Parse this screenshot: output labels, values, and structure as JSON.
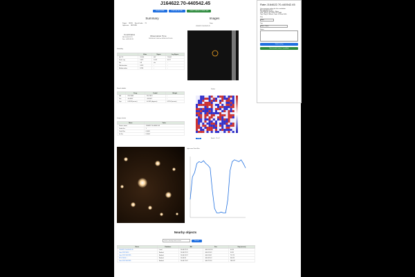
{
  "header": {
    "title": "J164622.70-440542.45",
    "buttons": [
      "SUBSCRIBE",
      "DISPLAY MORE",
      "LIGHTCURVE DOWNLOAD"
    ]
  },
  "summary": {
    "title": "Summary",
    "rows": [
      {
        "k": "Project",
        "v": "SDSS",
        "k2": "Search Index",
        "v2": "23"
      },
      {
        "k": "Lightcurve",
        "v": "BE7-KBN",
        "k2": "",
        "v2": ""
      }
    ],
    "coords_title": "Coordinates",
    "coords": [
      "RA: 16:46:22.70",
      "Dec: -44:05:42.45"
    ],
    "obs_title": "Observation Time",
    "obs": [
      "2023-01-01 10:00 to 2023-01-02 10:00"
    ]
  },
  "variability": {
    "title": "Variability",
    "headers": [
      "",
      "Value",
      "Sigma",
      "Log Sigma"
    ],
    "rows": [
      [
        "IQV T2",
        "74.201",
        "667",
        "71.962"
      ],
      [
        "Peak / sig",
        "2.012",
        "2.012",
        "3.577"
      ],
      [
        "Eta",
        "0.8",
        "n/a",
        "-"
      ],
      [
        "Std deviation",
        "0.913",
        "-",
        "-"
      ],
      [
        "Median index",
        "8.785",
        "-",
        "-"
      ]
    ]
  },
  "search_details": {
    "title": "Search details",
    "headers": [
      "",
      "Deep",
      "Coadd",
      "Weight"
    ],
    "rows": [
      [
        "RA",
        "251.5388",
        "252.7873",
        "-"
      ],
      [
        "Dec",
        "-44.0907",
        "-44.0907",
        "-"
      ],
      [
        "Sep",
        "0.0138 (arcsec)",
        "0.0162 (degrees)",
        "0.1154 (arcmin)"
      ]
    ]
  },
  "image_cutouts": {
    "title": "Image cutouts",
    "headers": [
      "Name",
      "Value"
    ],
    "rows": [
      [
        "Source name",
        "J164622.70-440542.45"
      ],
      [
        "Order flux",
        "1"
      ],
      [
        "Peak Flux",
        "0.0005"
      ],
      [
        "Int flux",
        "0.0004"
      ]
    ]
  },
  "images": {
    "title": "Images",
    "deep_label": "Deep",
    "deep_name": "J164622.70-440542.45",
    "stokes_label": "Stokes",
    "stokes_caption": "Epoch: #1 of 1",
    "lightcurve_label": "Lightcurve Peak Flux"
  },
  "rate": {
    "title": "Rate J164622.70-440542.45",
    "prompt": "Your previous rating for this candidate:",
    "not_variable": "Not variable? Yes",
    "tag": "Tag: Artefact (Noise) - None",
    "date": "Date: March 16, 2025 13:21 AM",
    "tag2": "Tag: 'Flag' & 'Mirror', Date: 02 Feb 2026",
    "fields": [
      {
        "label": "Flux",
        "value": "None"
      },
      {
        "label": "Tag",
        "value": "None - None"
      },
      {
        "label": "Notes",
        "value": ""
      }
    ],
    "submit": "Submit rating",
    "next": "Next unrated source / candidate"
  },
  "nearby": {
    "title": "Nearby objects",
    "search_placeholder": "Search nearby within arcsec",
    "search_btn": "Search",
    "headers": [
      "Name",
      "Database",
      "RA",
      "Dec",
      "Sep (arcsec)"
    ],
    "rows": [
      [
        "J164622.70-440542.45",
        "Local",
        "16:46:22.70",
        "-44:05:42.45",
        "0.014"
      ],
      [
        "Gaia DR3 5963...",
        "Simbad",
        "16:46:22.21",
        "-44:05:53.9",
        "9.031"
      ],
      [
        "Gaia DR3 5963782...",
        "Simbad",
        "16:46:15.57",
        "-44:05:36.1",
        "79.175"
      ],
      [
        "BTS 25850 / ...",
        "Simbad",
        "16:46:30",
        "-44:04:55.3",
        "90.029"
      ],
      [
        "Gaia DR3 5963782...",
        "Simbad",
        "16:46:17.67",
        "-44:07:13.4",
        "103.017"
      ]
    ]
  },
  "lightcurve_data": {
    "values": [
      0.2,
      0.45,
      0.5,
      0.6,
      0.62,
      0.61,
      0.63,
      0.6,
      0.58,
      0.55,
      0.3,
      0.1,
      0.05,
      0.05,
      0.06,
      0.05,
      0.05,
      0.2,
      0.52,
      0.62,
      0.64,
      0.63,
      0.62,
      0.64,
      0.6,
      0.55
    ]
  }
}
